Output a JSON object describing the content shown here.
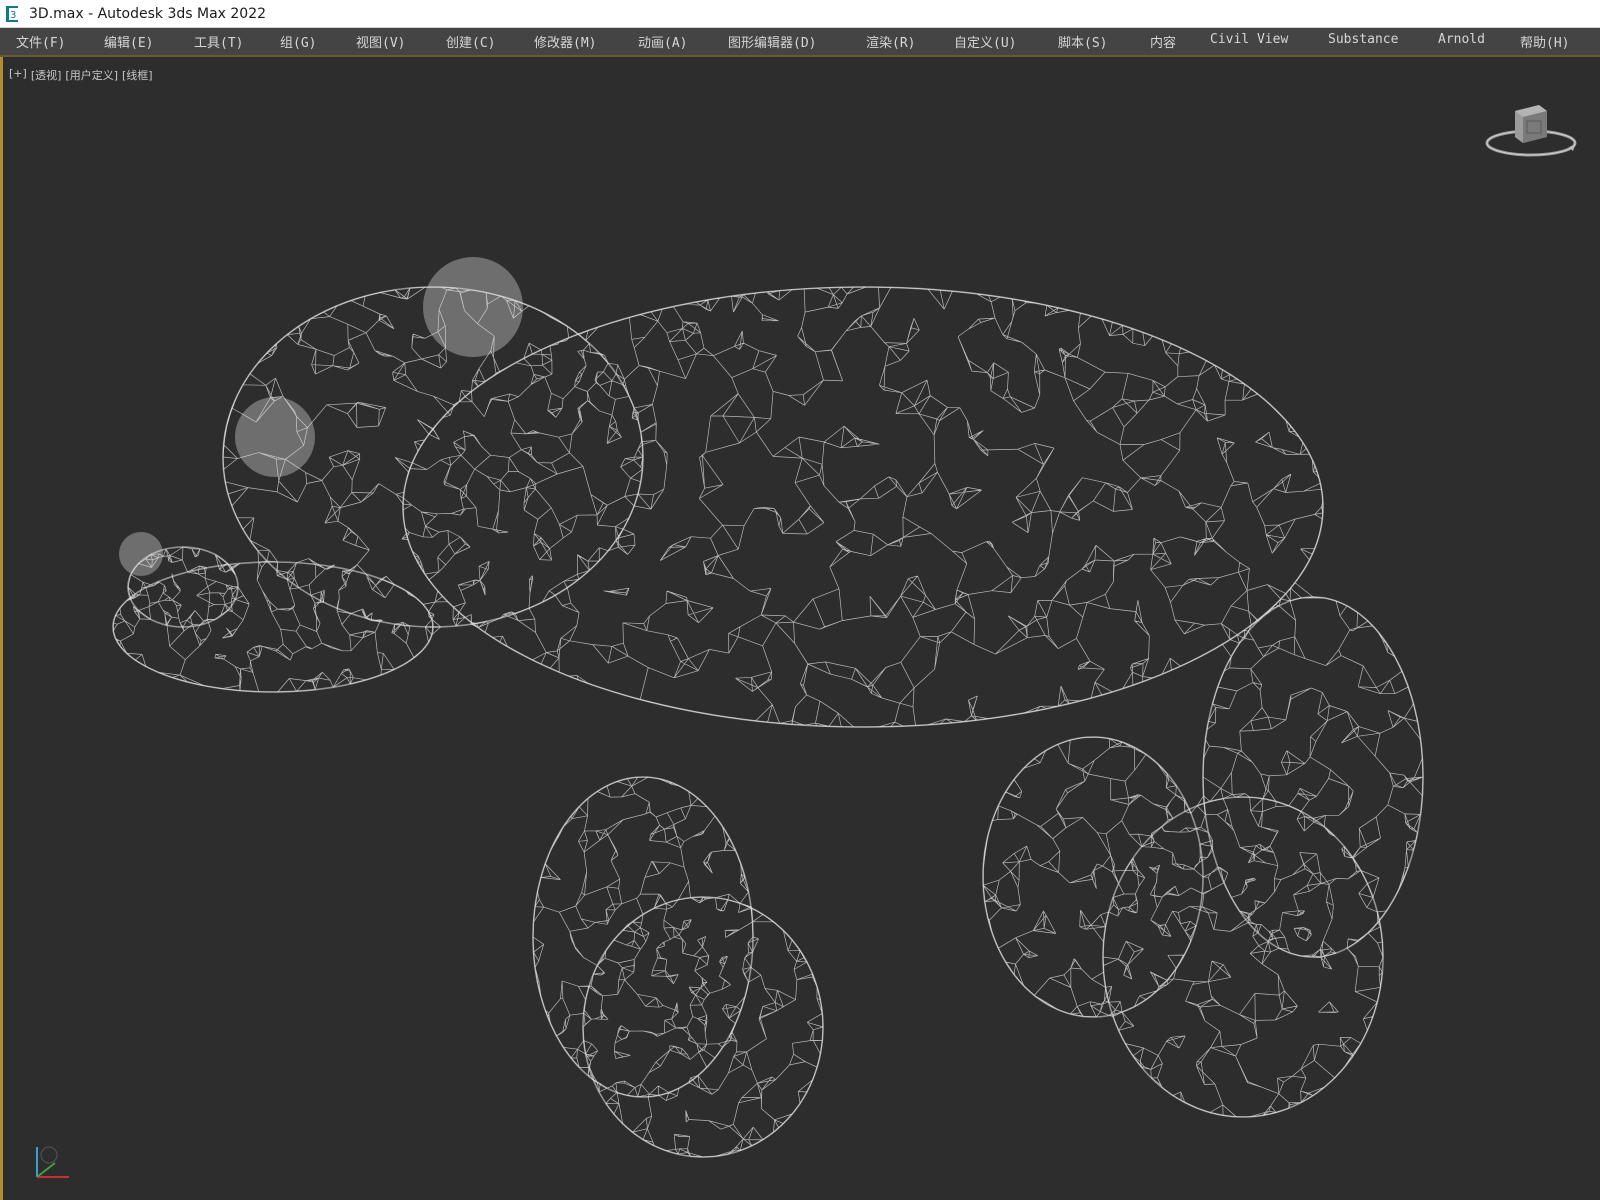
{
  "window": {
    "title": "3D.max - Autodesk 3ds Max 2022"
  },
  "menubar": {
    "items": [
      {
        "label": "文件(F)"
      },
      {
        "label": "编辑(E)"
      },
      {
        "label": "工具(T)"
      },
      {
        "label": "组(G)"
      },
      {
        "label": "视图(V)"
      },
      {
        "label": "创建(C)"
      },
      {
        "label": "修改器(M)"
      },
      {
        "label": "动画(A)"
      },
      {
        "label": "图形编辑器(D)"
      },
      {
        "label": "渲染(R)"
      },
      {
        "label": "自定义(U)"
      },
      {
        "label": "脚本(S)"
      },
      {
        "label": "内容"
      },
      {
        "label": "Civil View"
      },
      {
        "label": "Substance"
      },
      {
        "label": "Arnold"
      },
      {
        "label": "帮助(H)"
      }
    ]
  },
  "viewport": {
    "labels": [
      "[+]",
      "[透视]",
      "[用户定义]",
      "[线框]"
    ],
    "display_mode": "wireframe",
    "subject": "bear cub wireframe mesh"
  },
  "colors": {
    "menubar_bg": "#444444",
    "viewport_bg": "#2d2d2d",
    "active_border": "#b08e2a",
    "wire": "#e8e8e8"
  },
  "icons": {
    "app": "3dsmax-app-icon",
    "viewcube": "viewcube-icon",
    "axis": "axis-tripod-icon"
  }
}
